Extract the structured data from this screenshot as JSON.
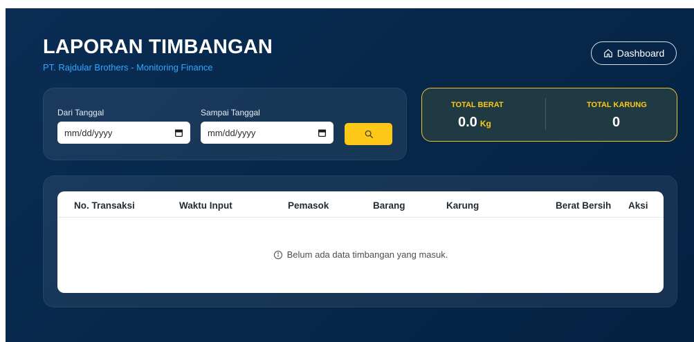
{
  "header": {
    "title": "LAPORAN TIMBANGAN",
    "subtitle": "PT. Rajdular Brothers - Monitoring Finance",
    "dashboard_button": "Dashboard"
  },
  "filters": {
    "from_label": "Dari Tanggal",
    "from_value": "mm/dd/yyyy",
    "to_label": "Sampai Tanggal",
    "to_value": "mm/dd/yyyy"
  },
  "totals": {
    "weight_label": "TOTAL BERAT",
    "weight_value": "0.0",
    "weight_unit": "Kg",
    "sacks_label": "TOTAL KARUNG",
    "sacks_value": "0"
  },
  "table": {
    "columns": [
      "No. Transaksi",
      "Waktu Input",
      "Pemasok",
      "Barang",
      "Karung",
      "Berat Bersih",
      "Aksi"
    ],
    "empty_message": "Belum ada data timbangan yang masuk."
  },
  "colors": {
    "accent": "#ffc816",
    "subtitle": "#2fa7ff",
    "background": "#0b2d55"
  },
  "icons": {
    "dashboard": "home-icon",
    "calendar": "calendar-icon",
    "search": "search-icon",
    "info": "info-icon"
  }
}
